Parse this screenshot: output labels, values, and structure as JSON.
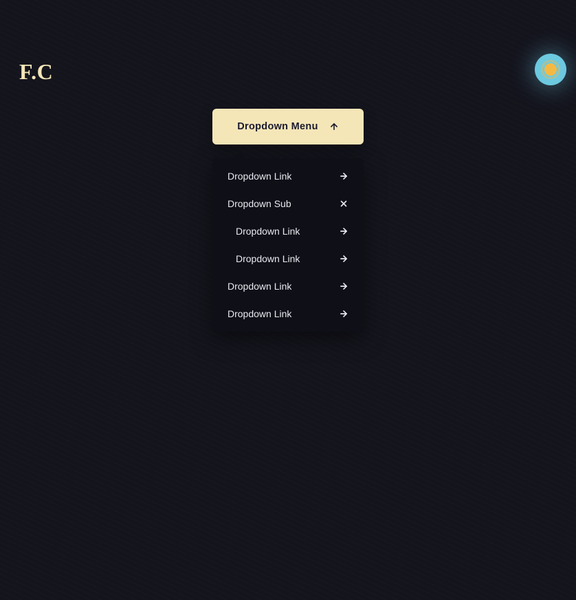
{
  "brand": {
    "logo": "F.C"
  },
  "colors": {
    "background": "#14141d",
    "accent": "#f5e6b8",
    "panel": "#0f0f18",
    "text_dark": "#1a1a2e",
    "text_light": "#e8e8f0",
    "toggle_bg": "#6cc9e0",
    "toggle_inner": "#f5b942"
  },
  "dropdown": {
    "button_label": "Dropdown Menu",
    "items": [
      {
        "label": "Dropdown Link",
        "type": "link"
      },
      {
        "label": "Dropdown Sub",
        "type": "submenu_open",
        "children": [
          {
            "label": "Dropdown Link",
            "type": "link"
          },
          {
            "label": "Dropdown Link",
            "type": "link"
          }
        ]
      },
      {
        "label": "Dropdown Link",
        "type": "link"
      },
      {
        "label": "Dropdown Link",
        "type": "link"
      }
    ]
  }
}
